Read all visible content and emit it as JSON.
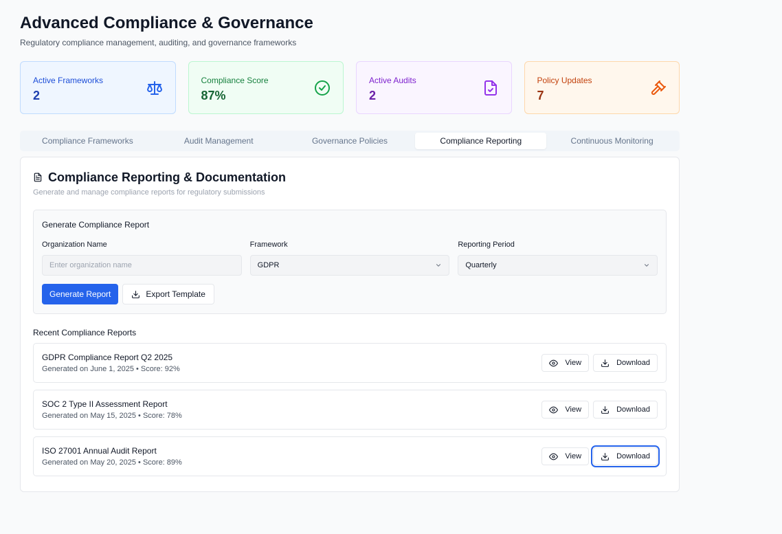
{
  "header": {
    "title": "Advanced Compliance & Governance",
    "subtitle": "Regulatory compliance management, auditing, and governance frameworks"
  },
  "stats": [
    {
      "label": "Active Frameworks",
      "value": "2",
      "icon": "scale-icon"
    },
    {
      "label": "Compliance Score",
      "value": "87%",
      "icon": "check-circle-icon"
    },
    {
      "label": "Active Audits",
      "value": "2",
      "icon": "file-check-icon"
    },
    {
      "label": "Policy Updates",
      "value": "7",
      "icon": "gavel-icon"
    }
  ],
  "tabs": [
    {
      "label": "Compliance Frameworks"
    },
    {
      "label": "Audit Management"
    },
    {
      "label": "Governance Policies"
    },
    {
      "label": "Compliance Reporting",
      "active": true
    },
    {
      "label": "Continuous Monitoring"
    }
  ],
  "reporting": {
    "title": "Compliance Reporting & Documentation",
    "description": "Generate and manage compliance reports for regulatory submissions",
    "generate": {
      "title": "Generate Compliance Report",
      "org_label": "Organization Name",
      "org_placeholder": "Enter organization name",
      "framework_label": "Framework",
      "framework_value": "GDPR",
      "period_label": "Reporting Period",
      "period_value": "Quarterly",
      "generate_button": "Generate Report",
      "export_button": "Export Template"
    },
    "recent_title": "Recent Compliance Reports",
    "view_label": "View",
    "download_label": "Download",
    "reports": [
      {
        "name": "GDPR Compliance Report Q2 2025",
        "meta": "Generated on June 1, 2025 • Score: 92%"
      },
      {
        "name": "SOC 2 Type II Assessment Report",
        "meta": "Generated on May 15, 2025 • Score: 78%"
      },
      {
        "name": "ISO 27001 Annual Audit Report",
        "meta": "Generated on May 20, 2025 • Score: 89%"
      }
    ]
  },
  "colors": {
    "primary": "#2563eb",
    "blue": "#1d4ed8",
    "green": "#15803d",
    "purple": "#7e22ce",
    "orange": "#c2410c"
  }
}
